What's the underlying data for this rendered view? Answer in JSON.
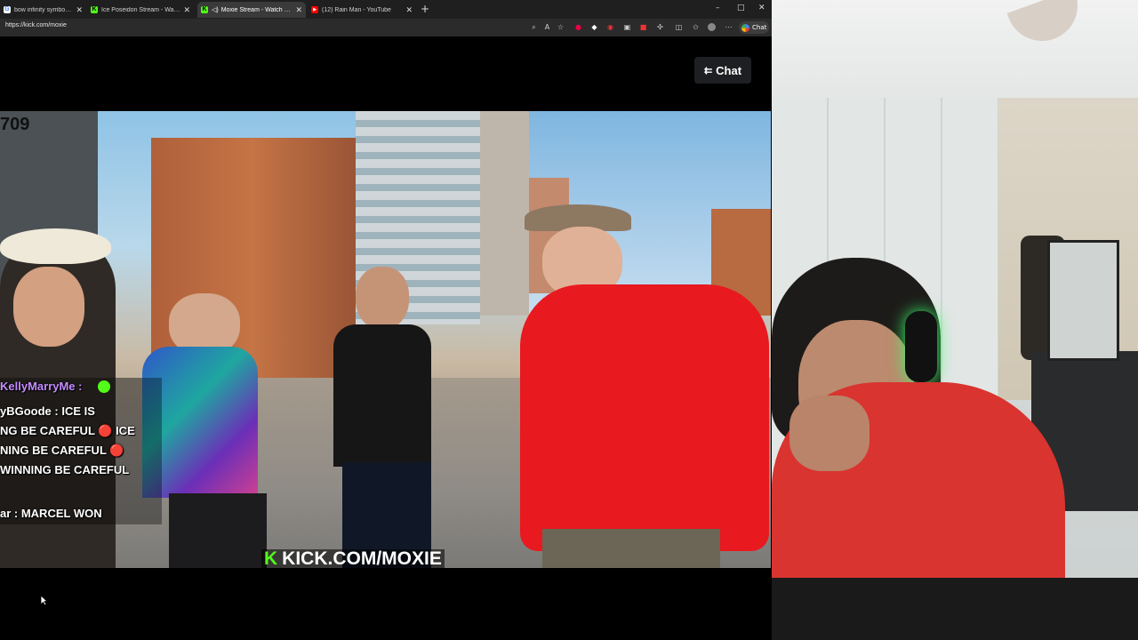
{
  "browser": {
    "tabs": [
      {
        "label": "bow infinity symbol - Google S",
        "favicon": "G",
        "active": false
      },
      {
        "label": "Ice Poseidon Stream - Watch Live",
        "favicon": "K",
        "active": false
      },
      {
        "label": "Moxie Stream - Watch Live o",
        "favicon": "K",
        "active": true
      },
      {
        "label": "(12) Rain Man - YouTube",
        "favicon": "▶",
        "active": false
      }
    ],
    "new_tab": "+",
    "window_controls": {
      "minimize": "–",
      "maximize": "□",
      "close": "✕"
    },
    "url": "https://kick.com/moxie",
    "chat_pill": "Chat"
  },
  "page": {
    "chat_button": "Chat",
    "video": {
      "counter": "709",
      "chat_lines": [
        {
          "text": "KellyMarryMe :",
          "kind": "name"
        },
        {
          "text": "yBGoode : ICE IS",
          "kind": "msg"
        },
        {
          "text": "NG BE CAREFUL  🔴  ICE",
          "kind": "msg"
        },
        {
          "text": "NING BE CAREFUL  🔴",
          "kind": "msg"
        },
        {
          "text": "WINNING BE CAREFUL",
          "kind": "msg"
        },
        {
          "text": "ar : MARCEL WON",
          "kind": "msg"
        }
      ],
      "watermark": "KICK.COM/MOXIE",
      "watermark_k": "K"
    }
  },
  "colors": {
    "kick_green": "#53fc18",
    "shirt_red": "#e8191f"
  }
}
